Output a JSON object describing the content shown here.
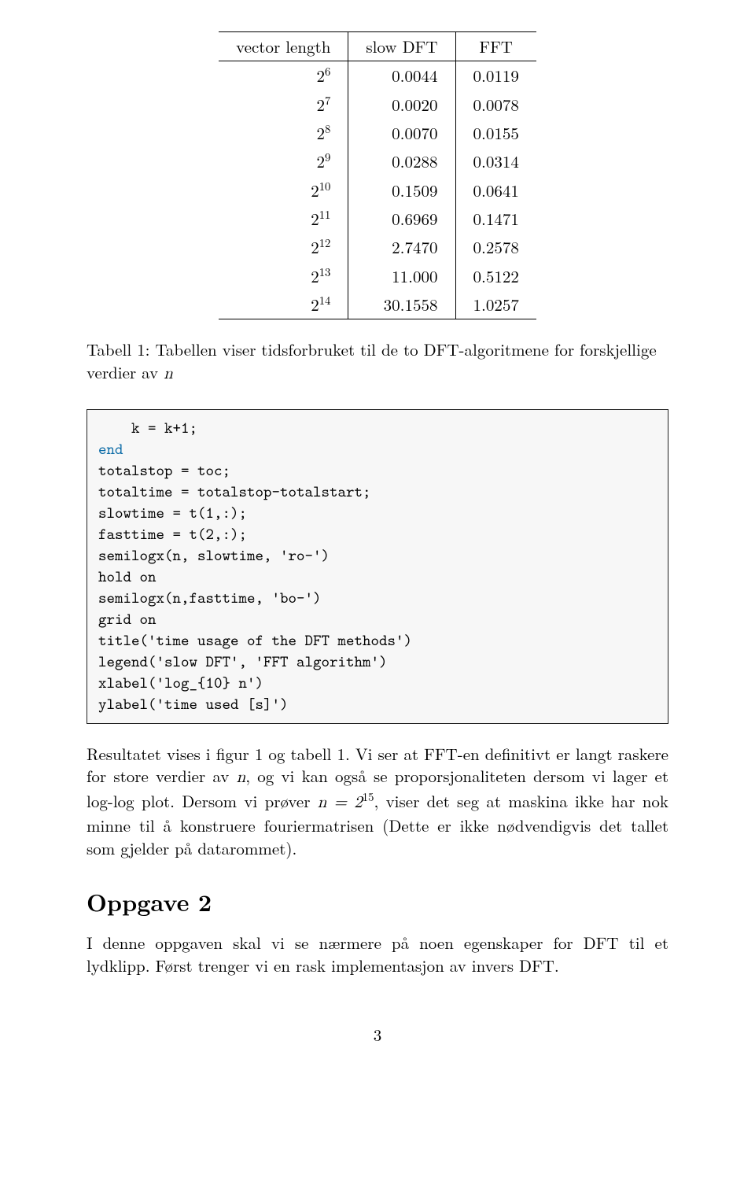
{
  "chart_data": {
    "type": "table",
    "title": "DFT timing table",
    "headers": [
      "vector length",
      "slow DFT",
      "FFT"
    ],
    "rows": [
      {
        "n": 6,
        "slow": "0.0044",
        "fft": "0.0119"
      },
      {
        "n": 7,
        "slow": "0.0020",
        "fft": "0.0078"
      },
      {
        "n": 8,
        "slow": "0.0070",
        "fft": "0.0155"
      },
      {
        "n": 9,
        "slow": "0.0288",
        "fft": "0.0314"
      },
      {
        "n": 10,
        "slow": "0.1509",
        "fft": "0.0641"
      },
      {
        "n": 11,
        "slow": "0.6969",
        "fft": "0.1471"
      },
      {
        "n": 12,
        "slow": "2.7470",
        "fft": "0.2578"
      },
      {
        "n": 13,
        "slow": "11.000",
        "fft": "0.5122"
      },
      {
        "n": 14,
        "slow": "30.1558",
        "fft": "1.0257"
      }
    ]
  },
  "caption_prefix": "Tabell 1: Tabellen viser tidsforbruket til de to DFT-algoritmene for forskjellige verdier av ",
  "caption_var": "n",
  "code": {
    "l1": "    k = k+1;",
    "l2": "end",
    "l3": "totalstop = toc;",
    "l4": "totaltime = totalstop-totalstart;",
    "l5": "slowtime = t(1,:);",
    "l6": "fasttime = t(2,:);",
    "l7": "semilogx(n, slowtime, 'ro-')",
    "l8": "hold on",
    "l9": "semilogx(n,fasttime, 'bo-')",
    "l10": "grid on",
    "l11": "title('time usage of the DFT methods')",
    "l12": "legend('slow DFT', 'FFT algorithm')",
    "l13": "xlabel('log_{10} n')",
    "l14": "ylabel('time used [s]')"
  },
  "para1_a": "Resultatet vises i figur 1 og tabell 1. Vi ser at FFT-en definitivt er langt raskere for store verdier av ",
  "para1_n": "n",
  "para1_b": ", og vi kan også se proporsjonaliteten dersom vi lager et log-log plot. Dersom vi prøver ",
  "para1_eq": "n = 2",
  "para1_exp": "15",
  "para1_c": ", viser det seg at maskina ikke har nok minne til å konstruere fouriermatrisen (Dette er ikke nødvendigvis det tallet som gjelder på datarommet).",
  "section_heading": "Oppgave 2",
  "para2": "I denne oppgaven skal vi se nærmere på noen egenskaper for DFT til et lydklipp. Først trenger vi en rask implementasjon av invers DFT.",
  "page_number": "3"
}
